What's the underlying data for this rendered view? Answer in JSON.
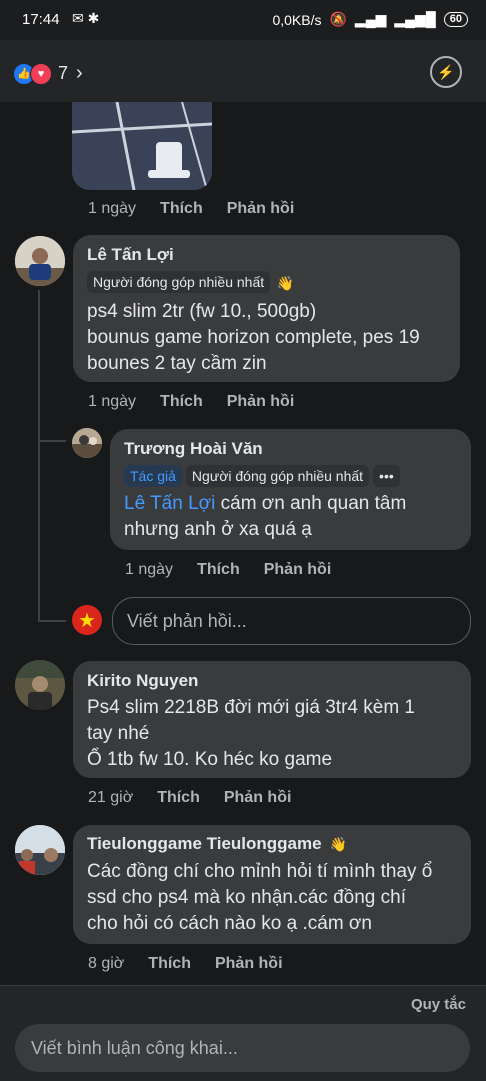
{
  "status": {
    "time": "17:44",
    "network": "0,0KB/s",
    "battery": "60"
  },
  "header": {
    "reaction_count": "7"
  },
  "comments": [
    {
      "meta": {
        "time": "1 ngày",
        "like": "Thích",
        "reply": "Phản hồi"
      }
    },
    {
      "name": "Lê Tấn Lợi",
      "badge": "Người đóng góp nhiều nhất",
      "lines": [
        "ps4 slim 2tr (fw 10., 500gb)",
        "bounus game horizon complete, pes 19",
        "bounes 2 tay cầm zin"
      ],
      "meta": {
        "time": "1 ngày",
        "like": "Thích",
        "reply": "Phản hồi"
      },
      "reply": {
        "name": "Trương Hoài Văn",
        "badge_author": "Tác giả",
        "badge": "Người đóng góp nhiều nhất",
        "mention": "Lê Tấn Lợi",
        "text1": " cám ơn anh quan tâm",
        "text2": "nhưng anh ở xa quá ạ",
        "meta": {
          "time": "1 ngày",
          "like": "Thích",
          "reply": "Phản hồi"
        }
      },
      "reply_placeholder": "Viết phản hồi..."
    },
    {
      "name": "Kirito Nguyen",
      "lines": [
        "Ps4 slim 2218B đời mới giá 3tr4 kèm 1",
        "tay nhé",
        "Ổ 1tb fw 10. Ko héc ko game"
      ],
      "meta": {
        "time": "21 giờ",
        "like": "Thích",
        "reply": "Phản hồi"
      }
    },
    {
      "name": "Tieulonggame Tieulonggame",
      "lines": [
        "Các đồng chí cho mỉnh hỏi tí mình thay ổ",
        "ssd cho ps4 mà ko nhận.các đồng chí",
        "cho hỏi có cách nào ko ạ .cám ơn"
      ],
      "meta": {
        "time": "8 giờ",
        "like": "Thích",
        "reply": "Phản hồi"
      }
    }
  ],
  "footer": {
    "rules": "Quy tắc",
    "placeholder": "Viết bình luận công khai..."
  }
}
